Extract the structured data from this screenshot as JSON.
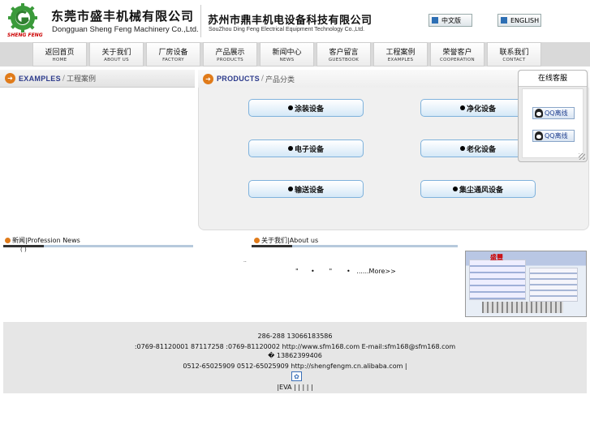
{
  "header": {
    "logo_text": "SHENG FENG",
    "company1_cn": "东莞市盛丰机械有限公司",
    "company1_en": "Dongguan Sheng Feng Machinery Co.,Ltd.",
    "company2_cn": "苏州市鼎丰机电设备科技有限公司",
    "company2_en": "SouZhou Ding Feng Electrical Equipment Technology Co.,Ltd.",
    "lang_cn": "中文版",
    "lang_en": "ENGLISH"
  },
  "nav": [
    {
      "cn": "返回首页",
      "en": "HOME"
    },
    {
      "cn": "关于我们",
      "en": "ABOUT US"
    },
    {
      "cn": "厂房设备",
      "en": "FACTORY"
    },
    {
      "cn": "产品展示",
      "en": "PRODUCTS"
    },
    {
      "cn": "新闻中心",
      "en": "NEWS"
    },
    {
      "cn": "客户留言",
      "en": "GUESTBOOK"
    },
    {
      "cn": "工程案例",
      "en": "EXAMPLES"
    },
    {
      "cn": "荣誉客户",
      "en": "COOPERATION"
    },
    {
      "cn": "联系我们",
      "en": "CONTACT"
    }
  ],
  "examples": {
    "en": "EXAMPLES",
    "sep": "/",
    "cn": "工程案例"
  },
  "products": {
    "en": "PRODUCTS",
    "sep": "/",
    "cn": "产品分类",
    "categories": [
      "涂装设备",
      "净化设备",
      "电子设备",
      "老化设备",
      "输送设备",
      "集尘通风设备"
    ]
  },
  "customer_service": {
    "title": "在线客服",
    "qq1": "QQ离线",
    "qq2": "QQ离线"
  },
  "news": {
    "title": "新闻|Profession News",
    "bracket": "( )"
  },
  "about": {
    "title": "关于我们|About us",
    "dots": "..",
    "snippet": "\"      •       \"       •   ......More>>",
    "photo_sign": "盛豐"
  },
  "footer": {
    "line1": "286-288        13066183586",
    "line2": ":0769-81120001  87117258   :0769-81120002 http://www.sfm168.com  E-mail:sfm168@sfm168.com",
    "line3": "�            13862399406",
    "line4": "0512-65025909    0512-65025909  http://shengfengm.cn.alibaba.com |",
    "icon": "paw-icon",
    "line5": "|EVA  |    |     |     |     |"
  },
  "colors": {
    "accent": "#e07b1a",
    "heading": "#2d3b8c",
    "button_border": "#7fb2dc"
  }
}
